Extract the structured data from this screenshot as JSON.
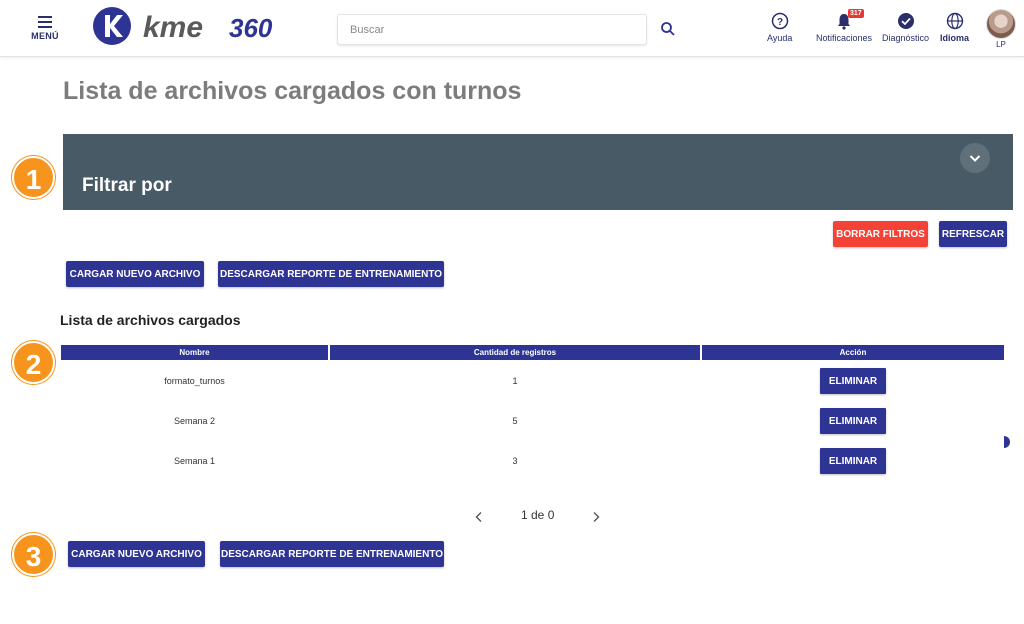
{
  "header": {
    "menu_label": "MENÚ",
    "search_placeholder": "Buscar",
    "nav": {
      "help": "Ayuda",
      "notifications": "Notificaciones",
      "notifications_count": "317",
      "diagnostic": "Diagnóstico",
      "language": "Idioma",
      "user": "LP"
    },
    "icons": [
      "menu-icon",
      "search-icon",
      "help-icon",
      "bell-icon",
      "check-circle-icon",
      "globe-icon",
      "avatar"
    ],
    "brand_color": "#2e3494"
  },
  "page": {
    "title": "Lista de archivos cargados con turnos"
  },
  "steps": [
    "1",
    "2",
    "3"
  ],
  "filter": {
    "title": "Filtrar por",
    "clear_label": "BORRAR FILTROS",
    "refresh_label": "REFRESCAR",
    "panel_color": "#475a66"
  },
  "actions": {
    "upload_label": "CARGAR NUEVO ARCHIVO",
    "download_label": "DESCARGAR REPORTE DE ENTRENAMIENTO"
  },
  "files": {
    "title": "Lista de archivos cargados",
    "columns": [
      "Nombre",
      "Cantidad de registros",
      "Acción"
    ],
    "rows": [
      {
        "name": "formato_turnos",
        "count": "1",
        "action": "ELIMINAR"
      },
      {
        "name": "Semana 2",
        "count": "5",
        "action": "ELIMINAR"
      },
      {
        "name": "Semana 1",
        "count": "3",
        "action": "ELIMINAR"
      }
    ]
  },
  "pagination": {
    "label": "1 de 0"
  },
  "colors": {
    "accent_orange": "#f7941d",
    "danger": "#f44336",
    "primary": "#2e3494"
  }
}
